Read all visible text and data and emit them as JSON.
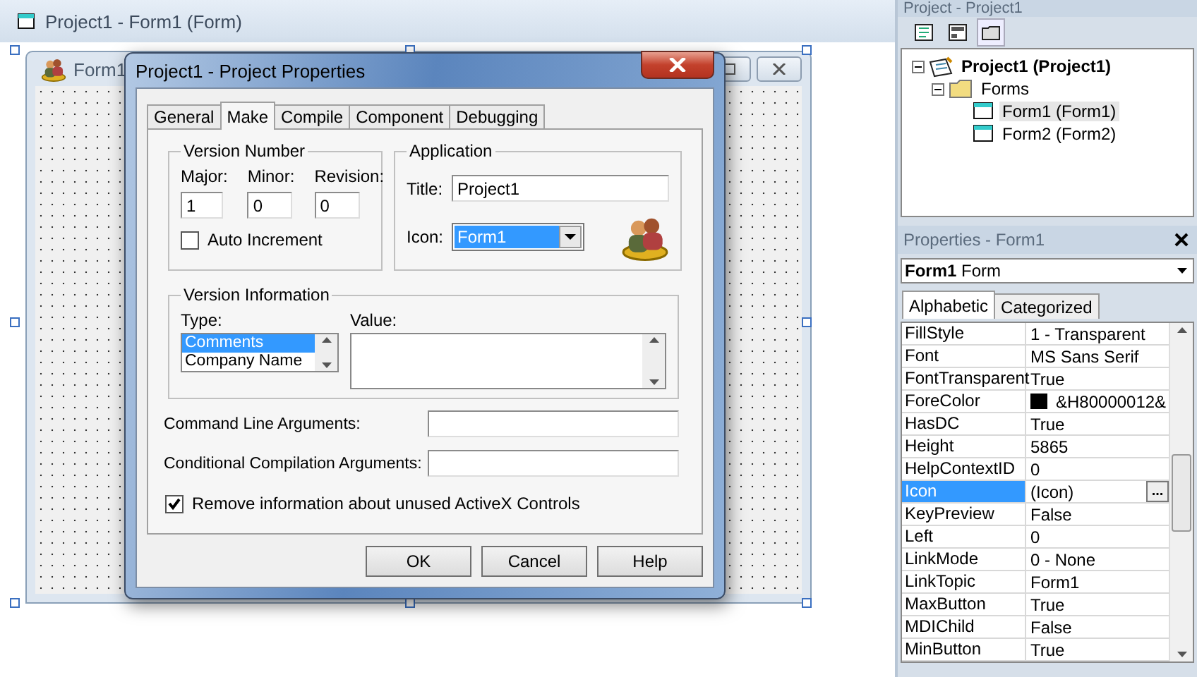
{
  "designer": {
    "title": "Project1 - Form1 (Form)",
    "form": {
      "title": "Form1"
    }
  },
  "dialog": {
    "title": "Project1 - Project Properties",
    "tabs": [
      {
        "label": "General",
        "selected": false
      },
      {
        "label": "Make",
        "selected": true
      },
      {
        "label": "Compile",
        "selected": false
      },
      {
        "label": "Component",
        "selected": false
      },
      {
        "label": "Debugging",
        "selected": false
      }
    ],
    "version_number": {
      "legend": "Version Number",
      "fields": [
        {
          "label": "Major:",
          "value": "1"
        },
        {
          "label": "Minor:",
          "value": "0"
        },
        {
          "label": "Revision:",
          "value": "0"
        }
      ],
      "auto_increment": {
        "label": "Auto Increment",
        "checked": false
      }
    },
    "application": {
      "legend": "Application",
      "title_label": "Title:",
      "title_value": "Project1",
      "icon_label": "Icon:",
      "icon_value": "Form1"
    },
    "version_information": {
      "legend": "Version Information",
      "type_label": "Type:",
      "value_label": "Value:",
      "types": [
        {
          "label": "Comments",
          "selected": true
        },
        {
          "label": "Company Name",
          "selected": false
        }
      ]
    },
    "command_line": {
      "label": "Command Line Arguments:"
    },
    "conditional_compilation": {
      "label": "Conditional Compilation Arguments:"
    },
    "remove_info": {
      "label": "Remove information about unused ActiveX Controls",
      "checked": true
    },
    "buttons": [
      "OK",
      "Cancel",
      "Help"
    ]
  },
  "project_explorer": {
    "title": "Project - Project1",
    "tree": [
      {
        "label": "Project1 (Project1)",
        "kind": "project",
        "expanded": true,
        "selected": false,
        "children": [
          {
            "label": "Forms",
            "kind": "folder",
            "expanded": true,
            "selected": false,
            "children": [
              {
                "label": "Form1 (Form1)",
                "kind": "form",
                "selected": true
              },
              {
                "label": "Form2 (Form2)",
                "kind": "form",
                "selected": false
              }
            ]
          }
        ]
      }
    ]
  },
  "properties": {
    "title": "Properties - Form1",
    "object": {
      "name": "Form1",
      "type": "Form"
    },
    "tabs": [
      {
        "label": "Alphabetic",
        "selected": true
      },
      {
        "label": "Categorized",
        "selected": false
      }
    ],
    "rows": [
      {
        "name": "FillStyle",
        "value": "1 - Transparent",
        "kind": "text",
        "selected": false
      },
      {
        "name": "Font",
        "value": "MS Sans Serif",
        "kind": "text",
        "selected": false
      },
      {
        "name": "FontTransparent",
        "value": "True",
        "kind": "text",
        "selected": false
      },
      {
        "name": "ForeColor",
        "value": "&H80000012&",
        "kind": "color",
        "color": "#000000",
        "selected": false
      },
      {
        "name": "HasDC",
        "value": "True",
        "kind": "text",
        "selected": false
      },
      {
        "name": "Height",
        "value": "5865",
        "kind": "text",
        "selected": false
      },
      {
        "name": "HelpContextID",
        "value": "0",
        "kind": "text",
        "selected": false
      },
      {
        "name": "Icon",
        "value": "(Icon)",
        "kind": "button",
        "button_label": "...",
        "selected": true
      },
      {
        "name": "KeyPreview",
        "value": "False",
        "kind": "text",
        "selected": false
      },
      {
        "name": "Left",
        "value": "0",
        "kind": "text",
        "selected": false
      },
      {
        "name": "LinkMode",
        "value": "0 - None",
        "kind": "text",
        "selected": false
      },
      {
        "name": "LinkTopic",
        "value": "Form1",
        "kind": "text",
        "selected": false
      },
      {
        "name": "MaxButton",
        "value": "True",
        "kind": "text",
        "selected": false
      },
      {
        "name": "MDIChild",
        "value": "False",
        "kind": "text",
        "selected": false
      },
      {
        "name": "MinButton",
        "value": "True",
        "kind": "text",
        "selected": false
      }
    ]
  }
}
